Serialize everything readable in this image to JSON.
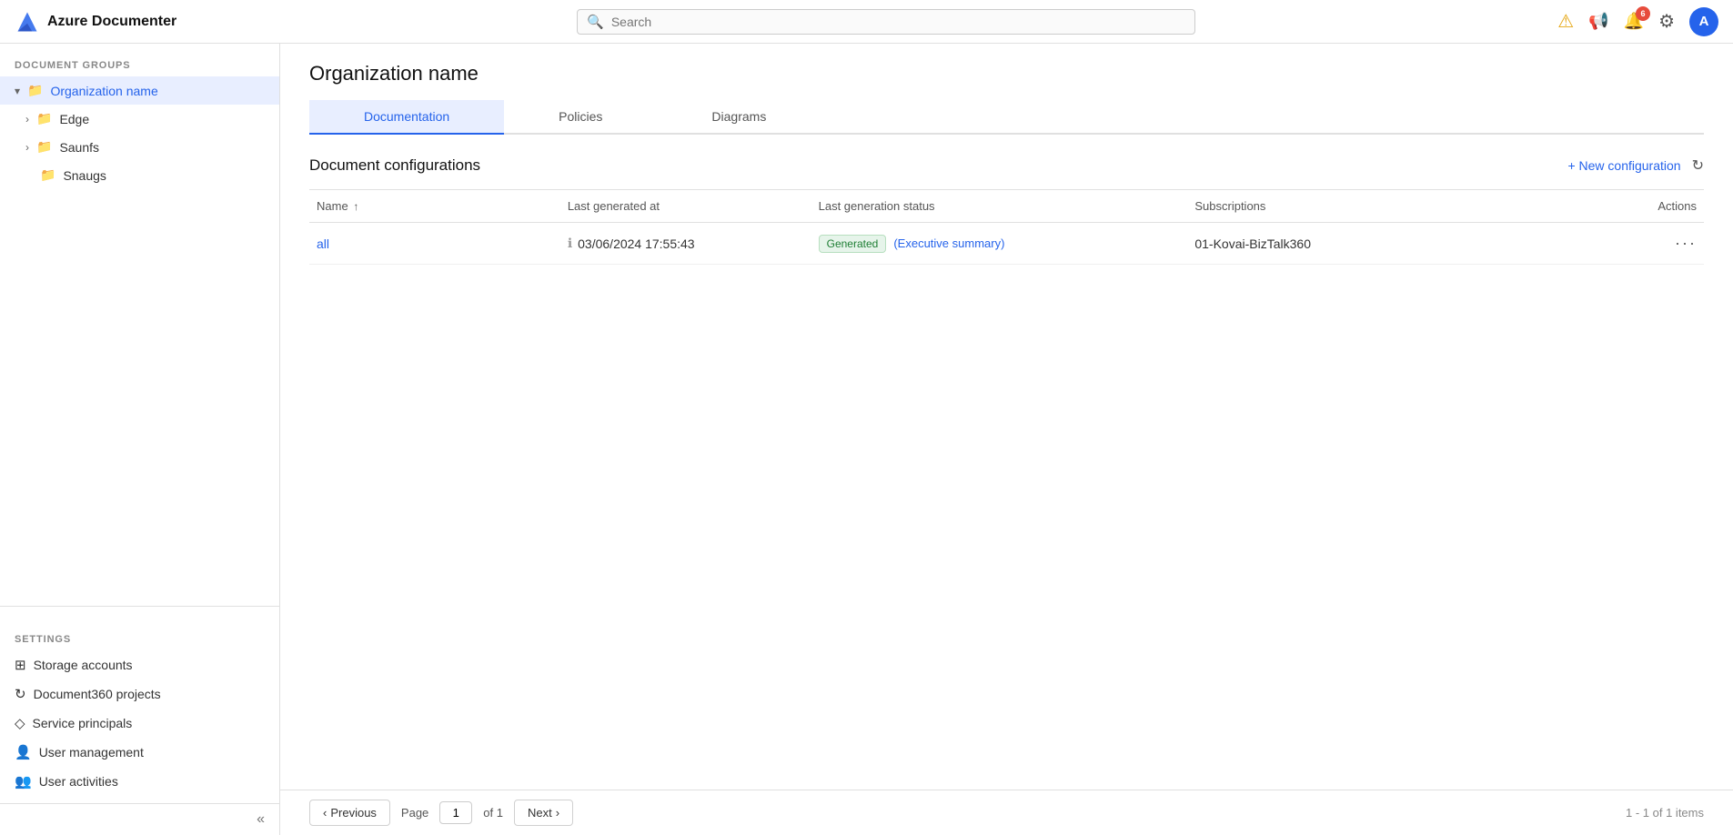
{
  "app": {
    "name": "Azure Documenter",
    "logo_letter": "A"
  },
  "topnav": {
    "search_placeholder": "Search",
    "avatar_letter": "A",
    "notification_count": "6"
  },
  "sidebar": {
    "document_groups_label": "Document Groups",
    "settings_label": "Settings",
    "groups": [
      {
        "id": "org",
        "label": "Organization name",
        "level": 0,
        "icon": "folder",
        "expanded": true,
        "active": true,
        "chevron": "▾"
      },
      {
        "id": "edge",
        "label": "Edge",
        "level": 1,
        "icon": "folder",
        "expanded": false,
        "chevron": "›"
      },
      {
        "id": "saunfs",
        "label": "Saunfs",
        "level": 1,
        "icon": "folder",
        "expanded": false,
        "chevron": "›"
      },
      {
        "id": "snaugs",
        "label": "Snaugs",
        "level": 2,
        "icon": "folder",
        "expanded": false
      }
    ],
    "settings_items": [
      {
        "id": "storage",
        "label": "Storage accounts",
        "icon": "grid"
      },
      {
        "id": "doc360",
        "label": "Document360 projects",
        "icon": "refresh-circle"
      },
      {
        "id": "service",
        "label": "Service principals",
        "icon": "diamond"
      },
      {
        "id": "usermgmt",
        "label": "User management",
        "icon": "person"
      },
      {
        "id": "useractivity",
        "label": "User activities",
        "icon": "person-group"
      }
    ],
    "collapse_label": "«"
  },
  "content": {
    "page_title": "Organization name",
    "tabs": [
      {
        "id": "documentation",
        "label": "Documentation",
        "active": true
      },
      {
        "id": "policies",
        "label": "Policies",
        "active": false
      },
      {
        "id": "diagrams",
        "label": "Diagrams",
        "active": false
      }
    ],
    "section_title": "Document configurations",
    "new_config_label": "+ New configuration",
    "table": {
      "columns": [
        {
          "id": "name",
          "label": "Name",
          "sort": "↑"
        },
        {
          "id": "generated",
          "label": "Last generated at"
        },
        {
          "id": "status",
          "label": "Last generation status"
        },
        {
          "id": "subscriptions",
          "label": "Subscriptions"
        },
        {
          "id": "actions",
          "label": "Actions"
        }
      ],
      "rows": [
        {
          "name": "all",
          "generated_at": "03/06/2024 17:55:43",
          "status_badge": "Generated",
          "status_link": "(Executive summary)",
          "subscriptions": "01-Kovai-BizTalk360",
          "actions": "···"
        }
      ]
    }
  },
  "pagination": {
    "previous_label": "Previous",
    "next_label": "Next",
    "page_label": "Page",
    "of_label": "of 1",
    "current_page": "1",
    "count_label": "1 - 1 of 1 items"
  }
}
